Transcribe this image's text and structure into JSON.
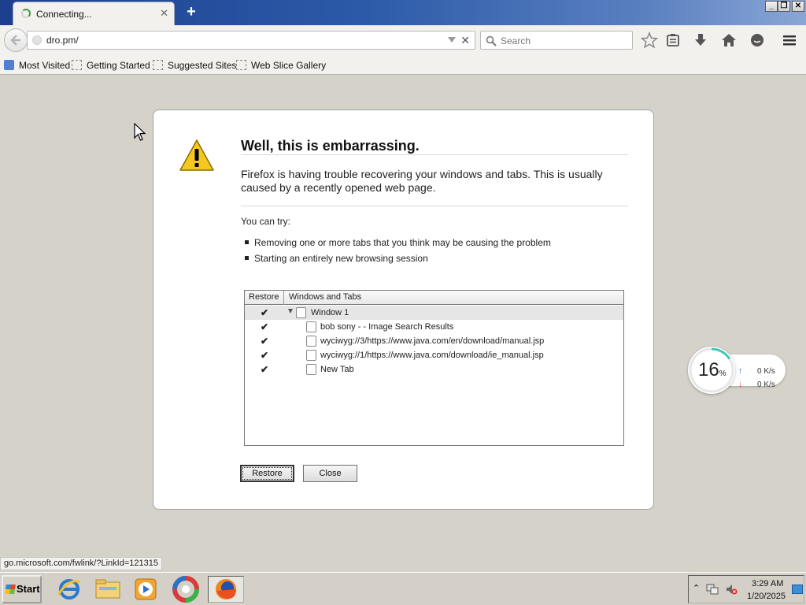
{
  "browser": {
    "tab_title": "Connecting...",
    "url": "dro.pm/",
    "search_placeholder": "Search"
  },
  "bookmarks": [
    "Most Visited",
    "Getting Started",
    "Suggested Sites",
    "Web Slice Gallery"
  ],
  "dialog": {
    "title": "Well, this is embarrassing.",
    "message": "Firefox is having trouble recovering your windows and tabs. This is usually caused by a recently opened web page.",
    "try_label": "You can try:",
    "suggestions": [
      "Removing one or more tabs that you think may be causing the problem",
      "Starting an entirely new browsing session"
    ],
    "tree": {
      "col_restore": "Restore",
      "col_windows": "Windows and Tabs",
      "window_label": "Window 1",
      "check_glyph": "✔",
      "tabs": [
        "bob sony - - Image Search Results",
        "wyciwyg://3/https://www.java.com/en/download/manual.jsp",
        "wyciwyg://1/https://www.java.com/download/ie_manual.jsp",
        "New Tab"
      ]
    },
    "restore_button": "Restore",
    "close_button": "Close"
  },
  "network_widget": {
    "percent": "16",
    "percent_unit": "%",
    "upload": "0 K/s",
    "download": "0 K/s"
  },
  "status_link": "go.microsoft.com/fwlink/?LinkId=121315",
  "taskbar": {
    "start_label": "Start",
    "clock_time": "3:29 AM",
    "clock_date": "1/20/2025"
  },
  "icons": {
    "tab_spinner": "loading-spinner-icon",
    "back": "back-arrow-icon",
    "warning": "warning-triangle-icon"
  },
  "colors": {
    "title_bar": "#2c5aa8",
    "page_background": "#d5d2ca",
    "upload_arrow": "#2a73c9",
    "download_arrow": "#d74a3a"
  }
}
